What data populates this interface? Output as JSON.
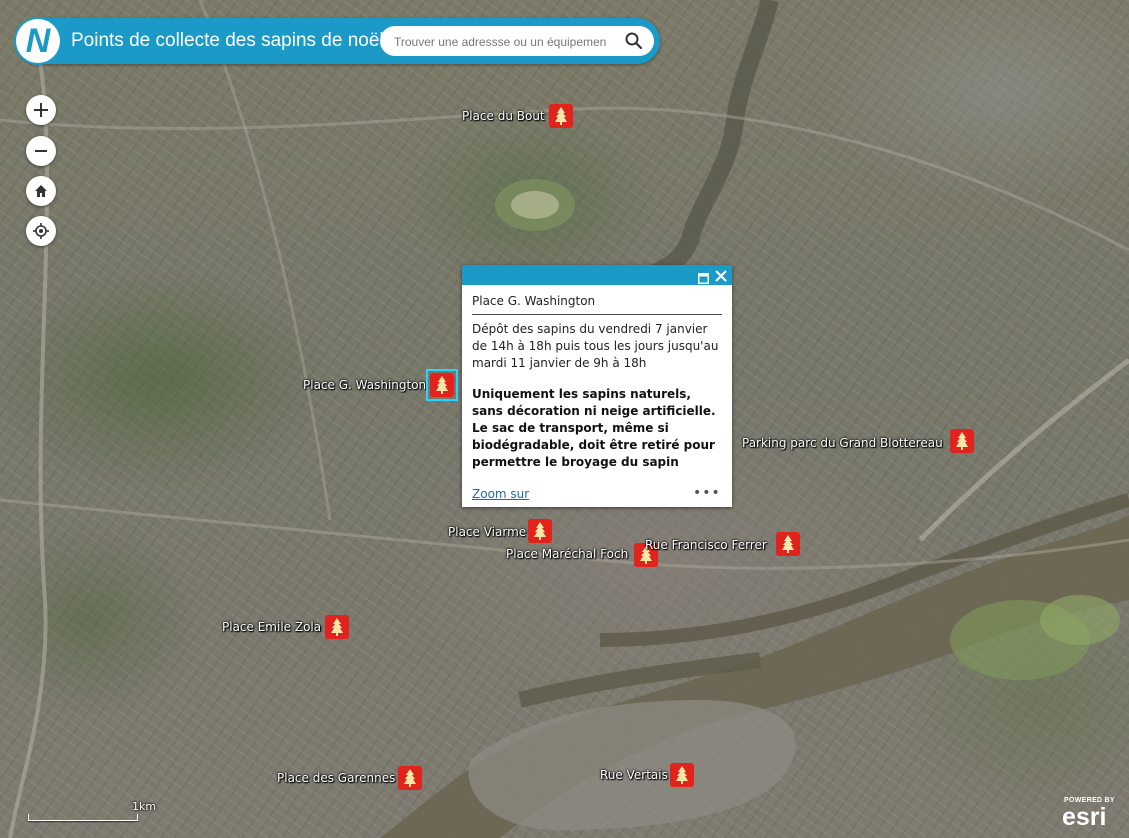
{
  "header": {
    "logo_letter": "N",
    "title": "Points de collecte des sapins de noël",
    "search_placeholder": "Trouver une adressse ou un équipement"
  },
  "icons": {
    "search": "search-icon",
    "zoom_in": "plus-icon",
    "zoom_out": "minus-icon",
    "home": "home-icon",
    "locate": "locate-icon",
    "marker": "christmas-tree-icon",
    "maximize": "maximize-icon",
    "close": "close-icon"
  },
  "colors": {
    "accent": "#1b9ac7",
    "marker": "#e0231c",
    "selection": "#29d3ff"
  },
  "markers": [
    {
      "label": "Place du Bout"
    },
    {
      "label": "Place G. Washington",
      "selected": true
    },
    {
      "label": "Parking parc du Grand Blottereau"
    },
    {
      "label": "Place Viarme"
    },
    {
      "label": "Place Maréchal Foch"
    },
    {
      "label": "Rue Francisco Ferrer"
    },
    {
      "label": "Place Emile Zola"
    },
    {
      "label": "Place des Garennes"
    },
    {
      "label": "Rue Vertais"
    }
  ],
  "popup": {
    "title": "Place G. Washington",
    "description": "Dépôt des sapins du vendredi 7 janvier de 14h à 18h puis tous les jours jusqu'au mardi 11 janvier de 9h à 18h",
    "notice": "Uniquement les sapins naturels, sans décoration ni neige artificielle. Le sac de transport, même si biodégradable, doit être retiré pour permettre le broyage du sapin",
    "zoom_link": "Zoom sur",
    "more": "•••"
  },
  "scale": {
    "label": "1km"
  },
  "attribution": {
    "powered_by": "POWERED BY",
    "brand": "esri"
  }
}
